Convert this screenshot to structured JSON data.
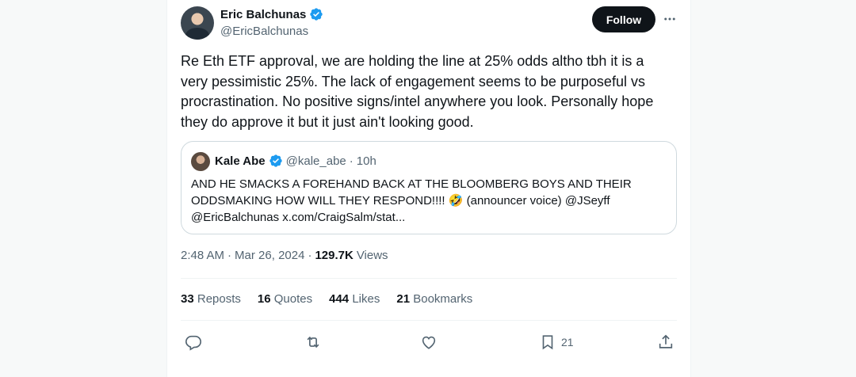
{
  "author": {
    "display_name": "Eric Balchunas",
    "handle": "@EricBalchunas"
  },
  "follow_label": "Follow",
  "tweet_text": "Re Eth ETF approval, we are holding the line at 25% odds altho tbh it is a very pessimistic 25%. The lack of engagement seems to be purposeful vs procrastination. No positive signs/intel anywhere you look. Personally hope they do approve it but it just ain't looking good.",
  "quote": {
    "display_name": "Kale Abe",
    "handle": "@kale_abe",
    "separator": "·",
    "time": "10h",
    "text": "AND HE SMACKS A FOREHAND BACK AT THE BLOOMBERG BOYS AND THEIR ODDSMAKING HOW WILL THEY RESPOND!!!! 🤣 (announcer voice) @JSeyff @EricBalchunas x.com/CraigSalm/stat..."
  },
  "meta": {
    "time": "2:48 AM",
    "sep1": "·",
    "date": "Mar 26, 2024",
    "sep2": "·",
    "views_count": "129.7K",
    "views_label": "Views"
  },
  "stats": {
    "reposts_count": "33",
    "reposts_label": "Reposts",
    "quotes_count": "16",
    "quotes_label": "Quotes",
    "likes_count": "444",
    "likes_label": "Likes",
    "bookmarks_count": "21",
    "bookmarks_label": "Bookmarks"
  },
  "actions": {
    "reply_icon": "reply-icon",
    "repost_icon": "repost-icon",
    "like_icon": "heart-icon",
    "bookmark_icon": "bookmark-icon",
    "bookmark_count": "21",
    "share_icon": "share-icon"
  },
  "colors": {
    "verified": "#1d9bf0",
    "text": "#0f1419",
    "secondary": "#536471",
    "border": "#cfd9de",
    "button_bg": "#0f1419"
  }
}
